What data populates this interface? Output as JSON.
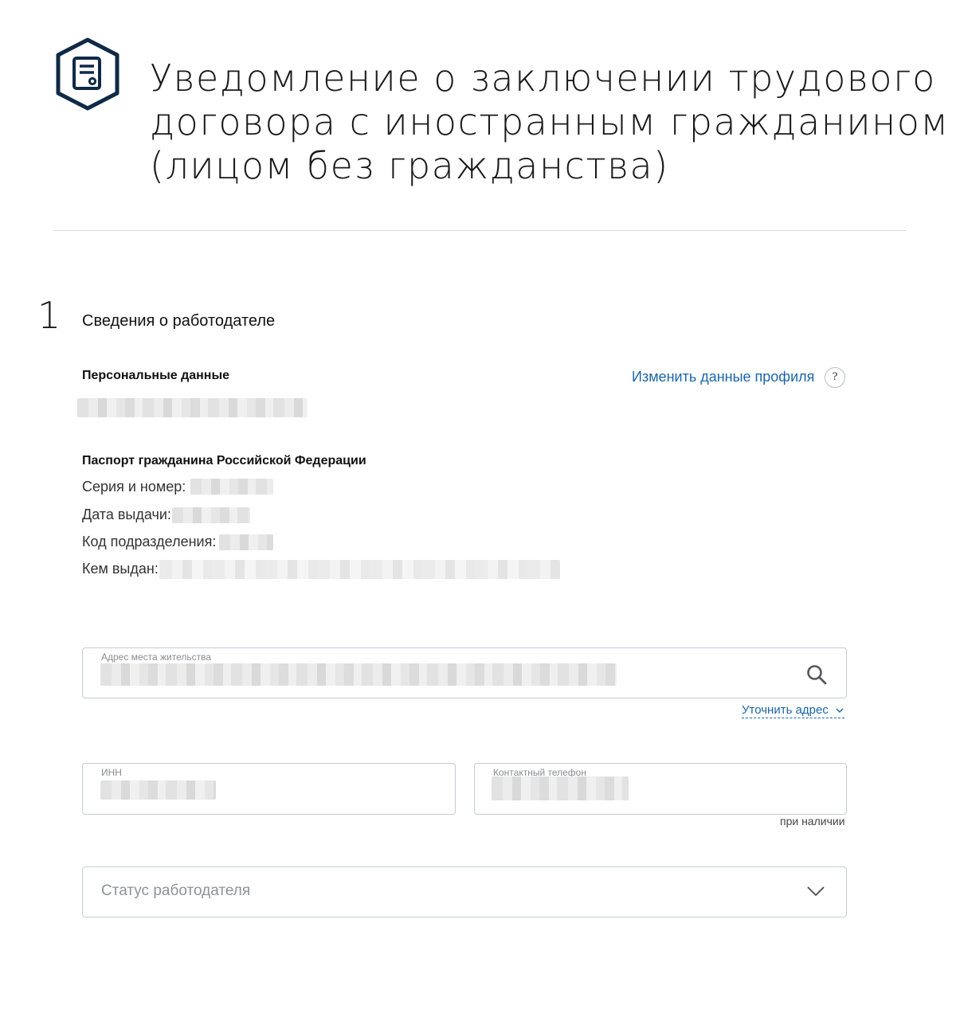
{
  "page": {
    "title_lines": [
      "Уведомление о заключении трудового",
      "договора с иностранным гражданином",
      "(лицом без гражданства)"
    ],
    "header_icon": "document-hexagon-icon"
  },
  "section": {
    "number": "1",
    "title": "Сведения о работодателе"
  },
  "personal": {
    "heading": "Персональные данные",
    "edit_link": "Изменить данные профиля",
    "help_label": "?",
    "name_value": "[скрыто]"
  },
  "passport": {
    "heading": "Паспорт гражданина Российской Федерации",
    "series_label": "Серия и номер:",
    "issue_date_label": "Дата выдачи:",
    "division_code_label": "Код подразделения:",
    "issued_by_label": "Кем выдан:"
  },
  "address": {
    "label": "Адрес места жительства",
    "search_icon": "search-icon",
    "refine_link": "Уточнить адрес"
  },
  "inn": {
    "label": "ИНН"
  },
  "phone": {
    "label": "Контактный телефон",
    "hint": "при наличии"
  },
  "status": {
    "placeholder": "Статус работодателя"
  },
  "colors": {
    "link": "#1c65a8",
    "text": "#0b1f33",
    "border": "#c6ccd3",
    "icon": "#0f2a45"
  }
}
